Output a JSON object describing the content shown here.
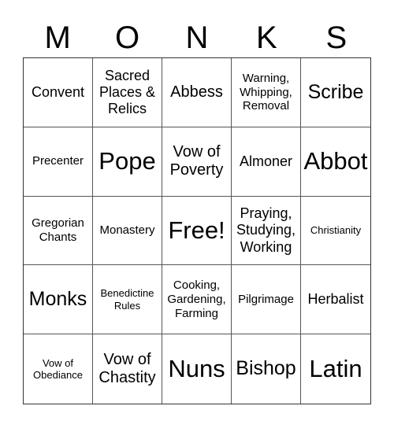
{
  "title_letters": [
    "M",
    "O",
    "N",
    "K",
    "S"
  ],
  "grid": [
    [
      {
        "text": "Convent",
        "size": "md"
      },
      {
        "text": "Sacred\nPlaces &\nRelics",
        "size": "md"
      },
      {
        "text": "Abbess",
        "size": "lg"
      },
      {
        "text": "Warning,\nWhipping,\nRemoval",
        "size": "sm"
      },
      {
        "text": "Scribe",
        "size": "xl"
      }
    ],
    [
      {
        "text": "Precenter",
        "size": "sm"
      },
      {
        "text": "Pope",
        "size": "xxl"
      },
      {
        "text": "Vow of\nPoverty",
        "size": "lg"
      },
      {
        "text": "Almoner",
        "size": "md"
      },
      {
        "text": "Abbot",
        "size": "xxl"
      }
    ],
    [
      {
        "text": "Gregorian\nChants",
        "size": "sm"
      },
      {
        "text": "Monastery",
        "size": "sm"
      },
      {
        "text": "Free!",
        "size": "xxl"
      },
      {
        "text": "Praying,\nStudying,\nWorking",
        "size": "md"
      },
      {
        "text": "Christianity",
        "size": "xs"
      }
    ],
    [
      {
        "text": "Monks",
        "size": "xl"
      },
      {
        "text": "Benedictine\nRules",
        "size": "xs"
      },
      {
        "text": "Cooking,\nGardening,\nFarming",
        "size": "sm"
      },
      {
        "text": "Pilgrimage",
        "size": "sm"
      },
      {
        "text": "Herbalist",
        "size": "md"
      }
    ],
    [
      {
        "text": "Vow of\nObediance",
        "size": "xs"
      },
      {
        "text": "Vow of\nChastity",
        "size": "lg"
      },
      {
        "text": "Nuns",
        "size": "xxl"
      },
      {
        "text": "Bishop",
        "size": "xl"
      },
      {
        "text": "Latin",
        "size": "xxl"
      }
    ]
  ]
}
